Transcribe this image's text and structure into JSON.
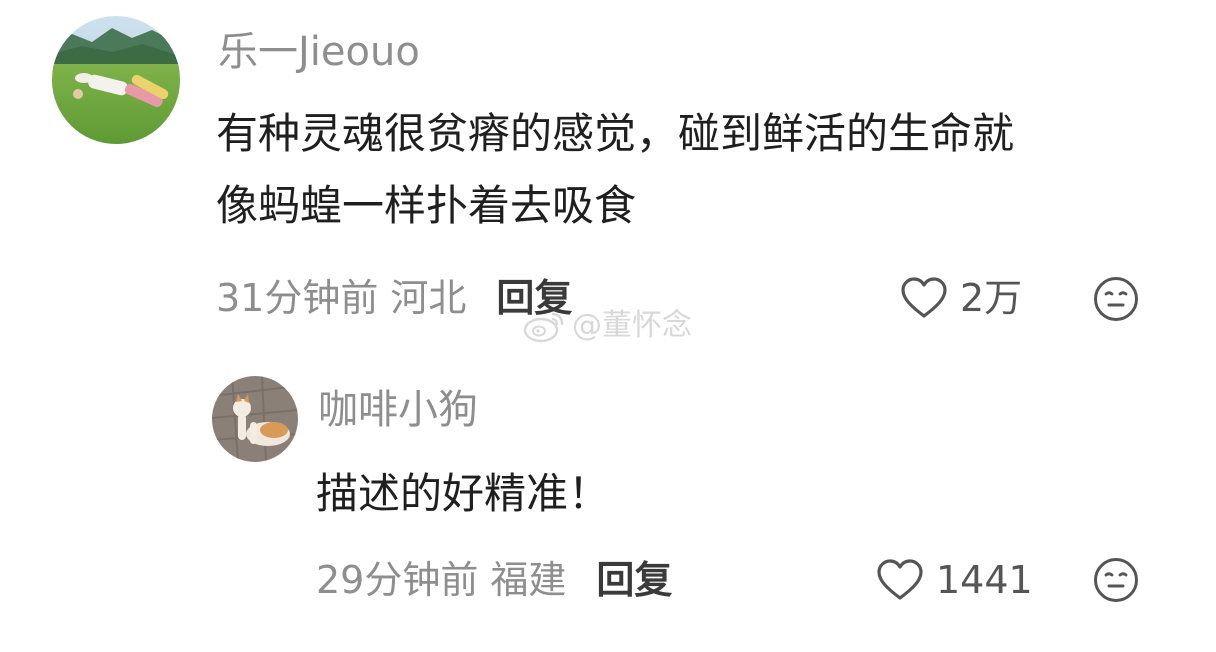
{
  "comments": [
    {
      "username": "乐一Jieouo",
      "text_lines": [
        "有种灵魂很贫瘠的感觉，碰到鲜活的生命就",
        "像蚂蝗一样扑着去吸食"
      ],
      "time": "31分钟前",
      "location": "河北",
      "reply_label": "回复",
      "like_count": "2万",
      "avatar_icon": "avatar-person-lying-on-grass",
      "reaction_icon": "neutral-face-icon"
    }
  ],
  "replies": [
    {
      "username": "咖啡小狗",
      "text_lines": [
        "描述的好精准！"
      ],
      "time": "29分钟前",
      "location": "福建",
      "reply_label": "回复",
      "like_count": "1441",
      "avatar_icon": "avatar-cat",
      "reaction_icon": "neutral-face-icon"
    }
  ],
  "watermark": {
    "text": "@董怀念",
    "icon": "weibo-logo-icon"
  },
  "colors": {
    "username": "#8e8e8e",
    "comment_text": "#1f1f1f",
    "meta": "#8e8e8e",
    "reply": "#3a3a3a",
    "icons": "#555555"
  }
}
